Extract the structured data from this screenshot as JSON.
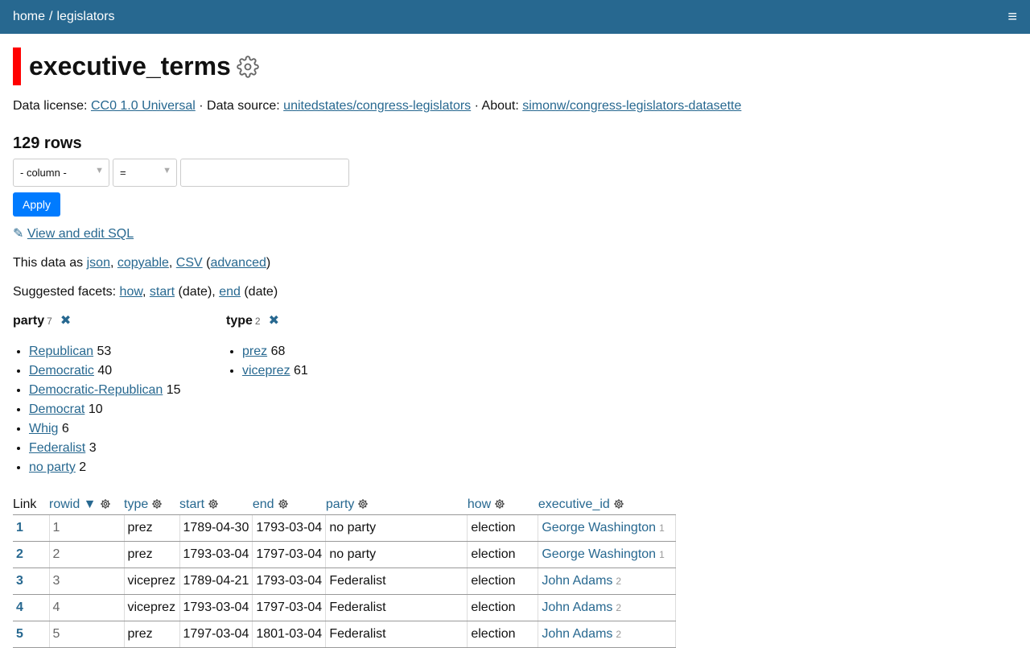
{
  "breadcrumb": {
    "home": "home",
    "sep": "/",
    "current": "legislators"
  },
  "menu_icon": "hamburger-icon",
  "title": "executive_terms",
  "meta": {
    "license_label": "Data license:",
    "license_link": "CC0 1.0 Universal",
    "source_label": "· Data source:",
    "source_link": "unitedstates/congress-legislators",
    "about_label": "· About:",
    "about_link": "simonw/congress-legislators-datasette"
  },
  "row_count": "129 rows",
  "filter": {
    "column_select": "- column -",
    "op_select": "=",
    "value": "",
    "apply_label": "Apply"
  },
  "sql_link": "View and edit SQL",
  "export": {
    "prefix": "This data as",
    "json": "json",
    "copyable": "copyable",
    "csv": "CSV",
    "advanced": "advanced"
  },
  "suggested": {
    "prefix": "Suggested facets:",
    "how": "how",
    "start": "start",
    "start_suffix": "(date),",
    "end": "end",
    "end_suffix": "(date)"
  },
  "facets": [
    {
      "name": "party",
      "count": "7",
      "items": [
        {
          "label": "Republican",
          "count": "53"
        },
        {
          "label": "Democratic",
          "count": "40"
        },
        {
          "label": "Democratic-Republican",
          "count": "15"
        },
        {
          "label": "Democrat",
          "count": "10"
        },
        {
          "label": "Whig",
          "count": "6"
        },
        {
          "label": "Federalist",
          "count": "3"
        },
        {
          "label": "no party",
          "count": "2"
        }
      ]
    },
    {
      "name": "type",
      "count": "2",
      "items": [
        {
          "label": "prez",
          "count": "68"
        },
        {
          "label": "viceprez",
          "count": "61"
        }
      ]
    }
  ],
  "table": {
    "headers": {
      "link": "Link",
      "rowid": "rowid ▼",
      "type": "type",
      "start": "start",
      "end": "end",
      "party": "party",
      "how": "how",
      "executive_id": "executive_id"
    },
    "rows": [
      {
        "link": "1",
        "rowid": "1",
        "type": "prez",
        "start": "1789-04-30",
        "end": "1793-03-04",
        "party": "no party",
        "how": "election",
        "exec_name": "George Washington",
        "exec_id": "1"
      },
      {
        "link": "2",
        "rowid": "2",
        "type": "prez",
        "start": "1793-03-04",
        "end": "1797-03-04",
        "party": "no party",
        "how": "election",
        "exec_name": "George Washington",
        "exec_id": "1"
      },
      {
        "link": "3",
        "rowid": "3",
        "type": "viceprez",
        "start": "1789-04-21",
        "end": "1793-03-04",
        "party": "Federalist",
        "how": "election",
        "exec_name": "John Adams",
        "exec_id": "2"
      },
      {
        "link": "4",
        "rowid": "4",
        "type": "viceprez",
        "start": "1793-03-04",
        "end": "1797-03-04",
        "party": "Federalist",
        "how": "election",
        "exec_name": "John Adams",
        "exec_id": "2"
      },
      {
        "link": "5",
        "rowid": "5",
        "type": "prez",
        "start": "1797-03-04",
        "end": "1801-03-04",
        "party": "Federalist",
        "how": "election",
        "exec_name": "John Adams",
        "exec_id": "2"
      }
    ]
  }
}
